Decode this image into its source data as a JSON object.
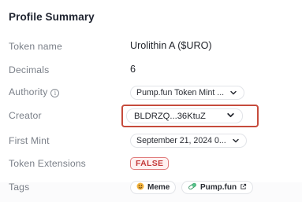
{
  "section": {
    "title": "Profile Summary"
  },
  "rows": {
    "token_name": {
      "label": "Token name",
      "value": "Urolithin A ($URO)"
    },
    "decimals": {
      "label": "Decimals",
      "value": "6"
    },
    "authority": {
      "label": "Authority",
      "value": "Pump.fun Token Mint ..."
    },
    "creator": {
      "label": "Creator",
      "value": "BLDRZQ...36KtuZ"
    },
    "first_mint": {
      "label": "First Mint",
      "value": "September 21, 2024 0..."
    },
    "token_extensions": {
      "label": "Token Extensions",
      "value": "FALSE"
    },
    "tags": {
      "label": "Tags",
      "items": [
        {
          "label": "Meme",
          "icon": "meme-icon"
        },
        {
          "label": "Pump.fun",
          "icon": "pill-icon",
          "trailing_icon": "external-link-icon"
        }
      ]
    }
  },
  "icons": {
    "info": "i"
  },
  "colors": {
    "highlight_border": "#c64b3c",
    "false_badge_text": "#c43b3b",
    "false_badge_bg": "#fff1f1"
  }
}
